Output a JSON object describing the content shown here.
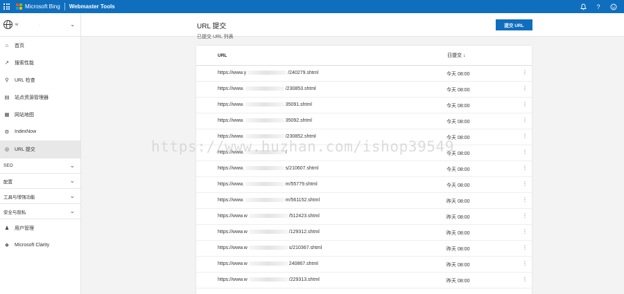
{
  "topbar": {
    "brand": "Microsoft Bing",
    "product": "Webmaster Tools",
    "icons": [
      "bell-icon",
      "help-icon",
      "smiley-icon"
    ],
    "logo_colors": [
      "#f25022",
      "#7fba00",
      "#00a4ef",
      "#ffb900"
    ]
  },
  "sidebar": {
    "site_name": "w",
    "site_suffix": ".",
    "items": [
      {
        "label": "首页",
        "icon": "home-icon"
      },
      {
        "label": "搜索性能",
        "icon": "trend-icon"
      },
      {
        "label": "URL 检查",
        "icon": "search-icon"
      },
      {
        "label": "站点资源管理器",
        "icon": "document-icon"
      },
      {
        "label": "网站地图",
        "icon": "sitemap-icon"
      },
      {
        "label": "IndexNow",
        "icon": "gear-icon"
      },
      {
        "label": "URL 提交",
        "icon": "globe-icon",
        "active": true
      }
    ],
    "groups": [
      "SEO",
      "配置",
      "工具与增强功能",
      "安全与隐私"
    ],
    "bottom_items": [
      {
        "label": "用户管理",
        "icon": "user-icon"
      },
      {
        "label": "Microsoft Clarity",
        "icon": "clarity-icon"
      }
    ]
  },
  "main": {
    "title": "URL 提交",
    "submit_label": "提交 URL",
    "section_label": "已提交 URL 列表",
    "columns": {
      "url": "URL",
      "date": "日提交 ↓"
    },
    "rows": [
      {
        "url_prefix": "https://www.y",
        "url_suffix": "/240279.shtml",
        "date": "今天 08:00"
      },
      {
        "url_prefix": "https://www.",
        "url_suffix": "/230853.shtml",
        "date": "今天 08:00"
      },
      {
        "url_prefix": "https://www.",
        "url_suffix": "35091.shtml",
        "date": "今天 08:00"
      },
      {
        "url_prefix": "https://www.",
        "url_suffix": "35092.shtml",
        "date": "今天 08:00"
      },
      {
        "url_prefix": "https://www.",
        "url_suffix": "/230852.shtml",
        "date": "今天 08:00"
      },
      {
        "url_prefix": "https://www.",
        "url_suffix": "/",
        "date": "今天 08:00"
      },
      {
        "url_prefix": "https://www.",
        "url_suffix": "s/210607.shtml",
        "date": "今天 08:00"
      },
      {
        "url_prefix": "https://www.",
        "url_suffix": "m/55779.shtml",
        "date": "今天 08:00"
      },
      {
        "url_prefix": "https://www.",
        "url_suffix": "m/561152.shtml",
        "date": "昨天 08:00"
      },
      {
        "url_prefix": "https://www.w",
        "url_suffix": "/512423.shtml",
        "date": "昨天 08:00"
      },
      {
        "url_prefix": "https://www.w",
        "url_suffix": "/129312.shtml",
        "date": "昨天 08:00"
      },
      {
        "url_prefix": "https://www.w",
        "url_suffix": "s/210367.shtml",
        "date": "昨天 08:00"
      },
      {
        "url_prefix": "https://www.w",
        "url_suffix": "240867.shtml",
        "date": "昨天 08:00"
      },
      {
        "url_prefix": "https://www.w",
        "url_suffix": "/229313.shtml",
        "date": "昨天 08:00"
      }
    ]
  },
  "watermark": "https://www.huzhan.com/ishop39549"
}
